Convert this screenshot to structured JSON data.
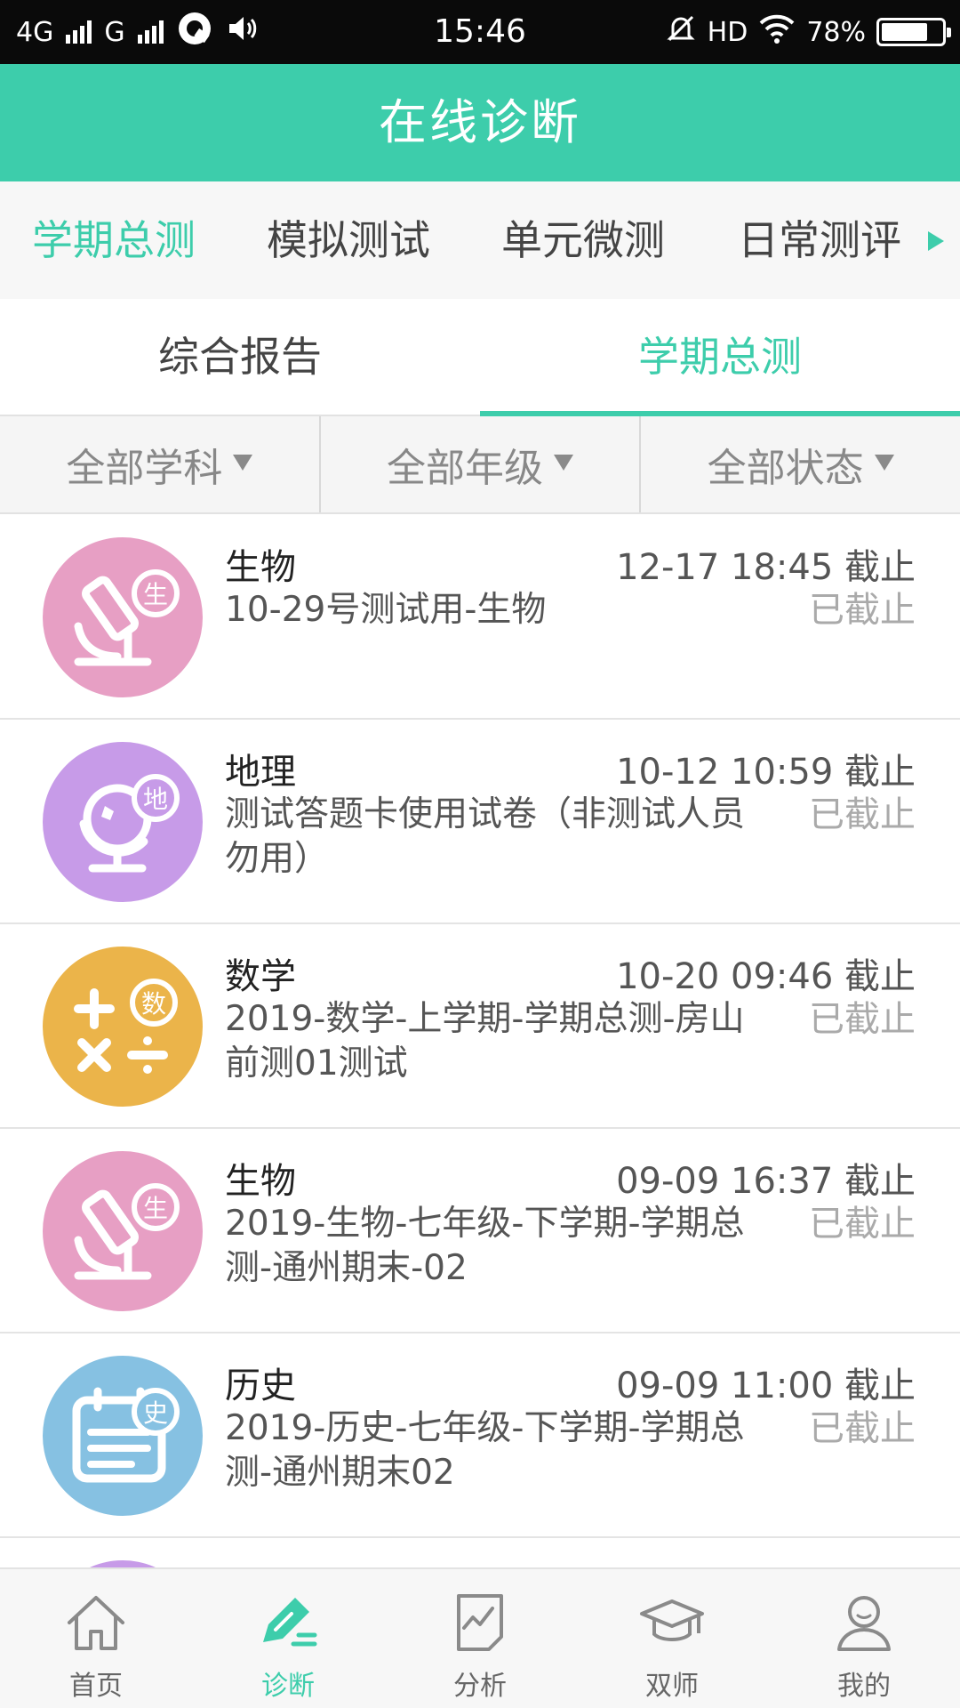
{
  "status_bar": {
    "network_1": "4G",
    "network_2": "G",
    "time": "15:46",
    "hd": "HD",
    "battery": "78%"
  },
  "header": {
    "title": "在线诊断"
  },
  "category_tabs": {
    "items": [
      {
        "label": "学期总测",
        "active": true
      },
      {
        "label": "模拟测试",
        "active": false
      },
      {
        "label": "单元微测",
        "active": false
      },
      {
        "label": "日常测评",
        "active": false
      }
    ]
  },
  "sub_tabs": {
    "items": [
      {
        "label": "综合报告",
        "active": false
      },
      {
        "label": "学期总测",
        "active": true
      }
    ]
  },
  "filters": {
    "items": [
      {
        "label": "全部学科"
      },
      {
        "label": "全部年级"
      },
      {
        "label": "全部状态"
      }
    ]
  },
  "exams": [
    {
      "subject": "生物",
      "icon": "microscope-icon",
      "badge": "生",
      "color": "#e79fc4",
      "deadline": "12-17 18:45 截止",
      "title": "10-29号测试用-生物",
      "status": "已截止"
    },
    {
      "subject": "地理",
      "icon": "globe-icon",
      "badge": "地",
      "color": "#c79be8",
      "deadline": "10-12 10:59 截止",
      "title": "测试答题卡使用试卷（非测试人员勿用）",
      "status": "已截止"
    },
    {
      "subject": "数学",
      "icon": "math-icon",
      "badge": "数",
      "color": "#ebb44a",
      "deadline": "10-20 09:46 截止",
      "title": "2019-数学-上学期-学期总测-房山前测01测试",
      "status": "已截止"
    },
    {
      "subject": "生物",
      "icon": "microscope-icon",
      "badge": "生",
      "color": "#e79fc4",
      "deadline": "09-09 16:37 截止",
      "title": "2019-生物-七年级-下学期-学期总测-通州期末-02",
      "status": "已截止"
    },
    {
      "subject": "历史",
      "icon": "calendar-icon",
      "badge": "史",
      "color": "#86c1e2",
      "deadline": "09-09 11:00 截止",
      "title": "2019-历史-七年级-下学期-学期总测-通州期末02",
      "status": "已截止"
    }
  ],
  "bottom_nav": {
    "items": [
      {
        "label": "首页",
        "icon": "home-icon",
        "active": false
      },
      {
        "label": "诊断",
        "icon": "diagnose-icon",
        "active": true
      },
      {
        "label": "分析",
        "icon": "analysis-icon",
        "active": false
      },
      {
        "label": "双师",
        "icon": "graduation-cap-icon",
        "active": false
      },
      {
        "label": "我的",
        "icon": "user-icon",
        "active": false
      }
    ]
  },
  "colors": {
    "accent": "#3dcdab",
    "muted": "#aaaaaa"
  }
}
